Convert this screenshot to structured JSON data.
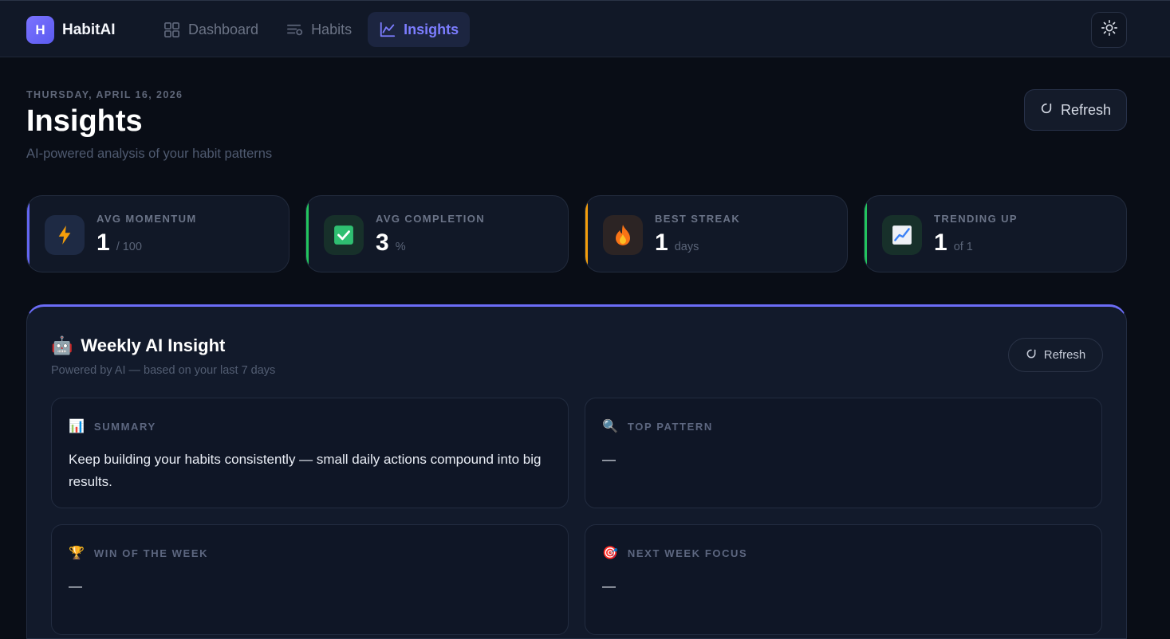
{
  "app": {
    "logo_letter": "H",
    "name": "HabitAI"
  },
  "nav": {
    "items": [
      {
        "label": "Dashboard",
        "icon": "grid-icon"
      },
      {
        "label": "Habits",
        "icon": "list-filter-icon"
      },
      {
        "label": "Insights",
        "icon": "line-chart-icon",
        "active": true
      }
    ]
  },
  "header": {
    "date": "THURSDAY, APRIL 16, 2026",
    "title": "Insights",
    "subtitle": "AI-powered analysis of your habit patterns",
    "refresh_label": "Refresh"
  },
  "stats": [
    {
      "label": "AVG MOMENTUM",
      "value": "1",
      "unit": "/ 100",
      "icon": "lightning-icon",
      "accent": "#6366f1"
    },
    {
      "label": "AVG COMPLETION",
      "value": "3",
      "unit": "%",
      "icon": "check-box-icon",
      "accent": "#22c55e"
    },
    {
      "label": "BEST STREAK",
      "value": "1",
      "unit": "days",
      "icon": "fire-icon",
      "accent": "#f59e0b"
    },
    {
      "label": "TRENDING UP",
      "value": "1",
      "unit": "of 1",
      "icon": "chart-up-icon",
      "accent": "#22c55e"
    }
  ],
  "weekly": {
    "emoji": "🤖",
    "title": "Weekly AI Insight",
    "subtitle": "Powered by AI — based on your last 7 days",
    "refresh_label": "Refresh",
    "cards": [
      {
        "emoji": "📊",
        "label": "SUMMARY",
        "text": "Keep building your habits consistently — small daily actions compound into big results."
      },
      {
        "emoji": "🔍",
        "label": "TOP PATTERN",
        "text": "—"
      },
      {
        "emoji": "🏆",
        "label": "WIN OF THE WEEK",
        "text": "—"
      },
      {
        "emoji": "🎯",
        "label": "NEXT WEEK FOCUS",
        "text": "—"
      }
    ]
  },
  "colors": {
    "accent": "#6b6cf6",
    "background": "#090d16",
    "surface": "#111827"
  }
}
